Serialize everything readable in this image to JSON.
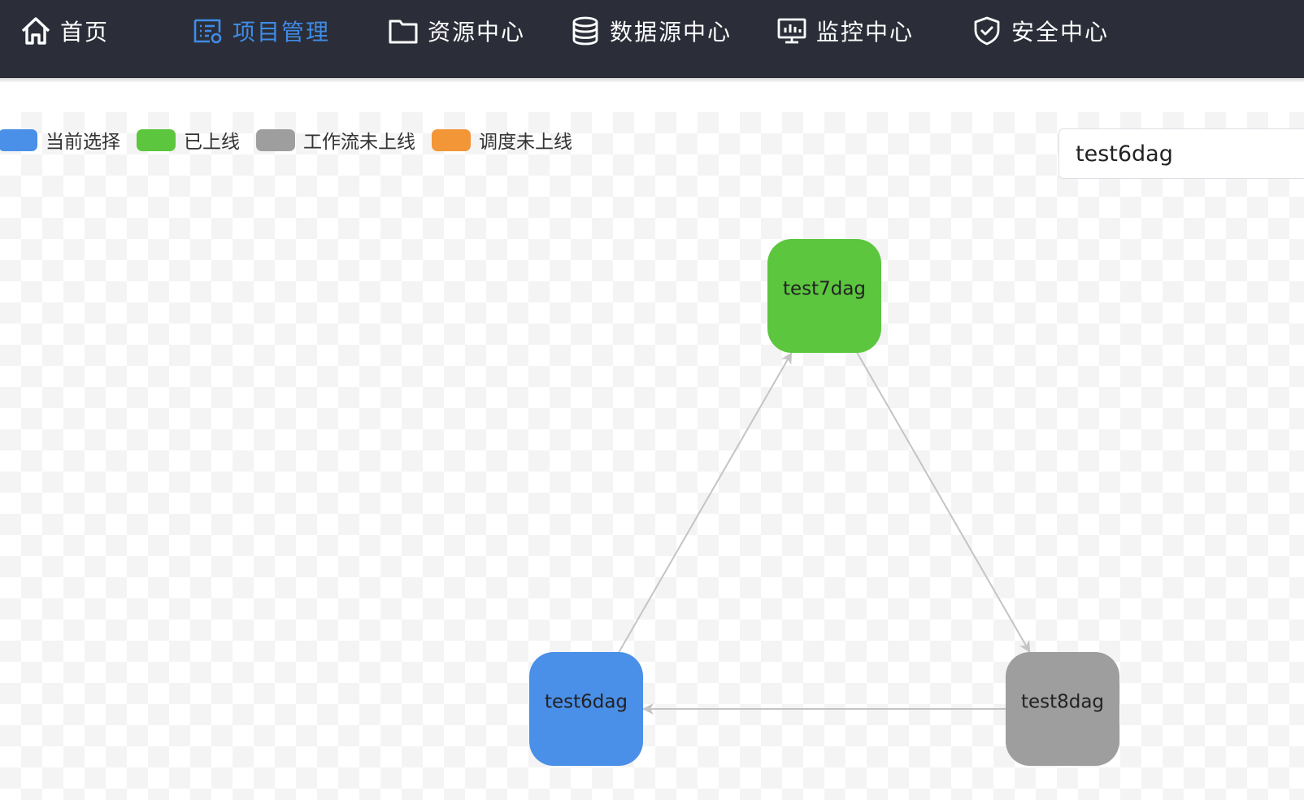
{
  "nav": {
    "items": [
      {
        "label": "首页",
        "icon": "home-icon",
        "active": false
      },
      {
        "label": "项目管理",
        "icon": "project-icon",
        "active": true
      },
      {
        "label": "资源中心",
        "icon": "folder-icon",
        "active": false
      },
      {
        "label": "数据源中心",
        "icon": "database-icon",
        "active": false
      },
      {
        "label": "监控中心",
        "icon": "monitor-icon",
        "active": false
      },
      {
        "label": "安全中心",
        "icon": "shield-icon",
        "active": false
      }
    ],
    "background": "#2b2e38",
    "active_color": "#3f8ce8"
  },
  "legend": {
    "items": [
      {
        "label": "当前选择",
        "color": "#4a8fe8"
      },
      {
        "label": "已上线",
        "color": "#5bc63e"
      },
      {
        "label": "工作流未上线",
        "color": "#9e9e9e"
      },
      {
        "label": "调度未上线",
        "color": "#f29637"
      }
    ]
  },
  "search": {
    "value": "test6dag"
  },
  "graph": {
    "nodes": [
      {
        "id": "test7dag",
        "label": "test7dag",
        "status": "已上线",
        "color": "#5bc63e"
      },
      {
        "id": "test6dag",
        "label": "test6dag",
        "status": "当前选择",
        "color": "#4a8fe8"
      },
      {
        "id": "test8dag",
        "label": "test8dag",
        "status": "工作流未上线",
        "color": "#9e9e9e"
      }
    ],
    "edges": [
      {
        "from": "test6dag",
        "to": "test7dag"
      },
      {
        "from": "test7dag",
        "to": "test8dag"
      },
      {
        "from": "test8dag",
        "to": "test6dag"
      }
    ],
    "edge_color": "#c4c4c4"
  }
}
